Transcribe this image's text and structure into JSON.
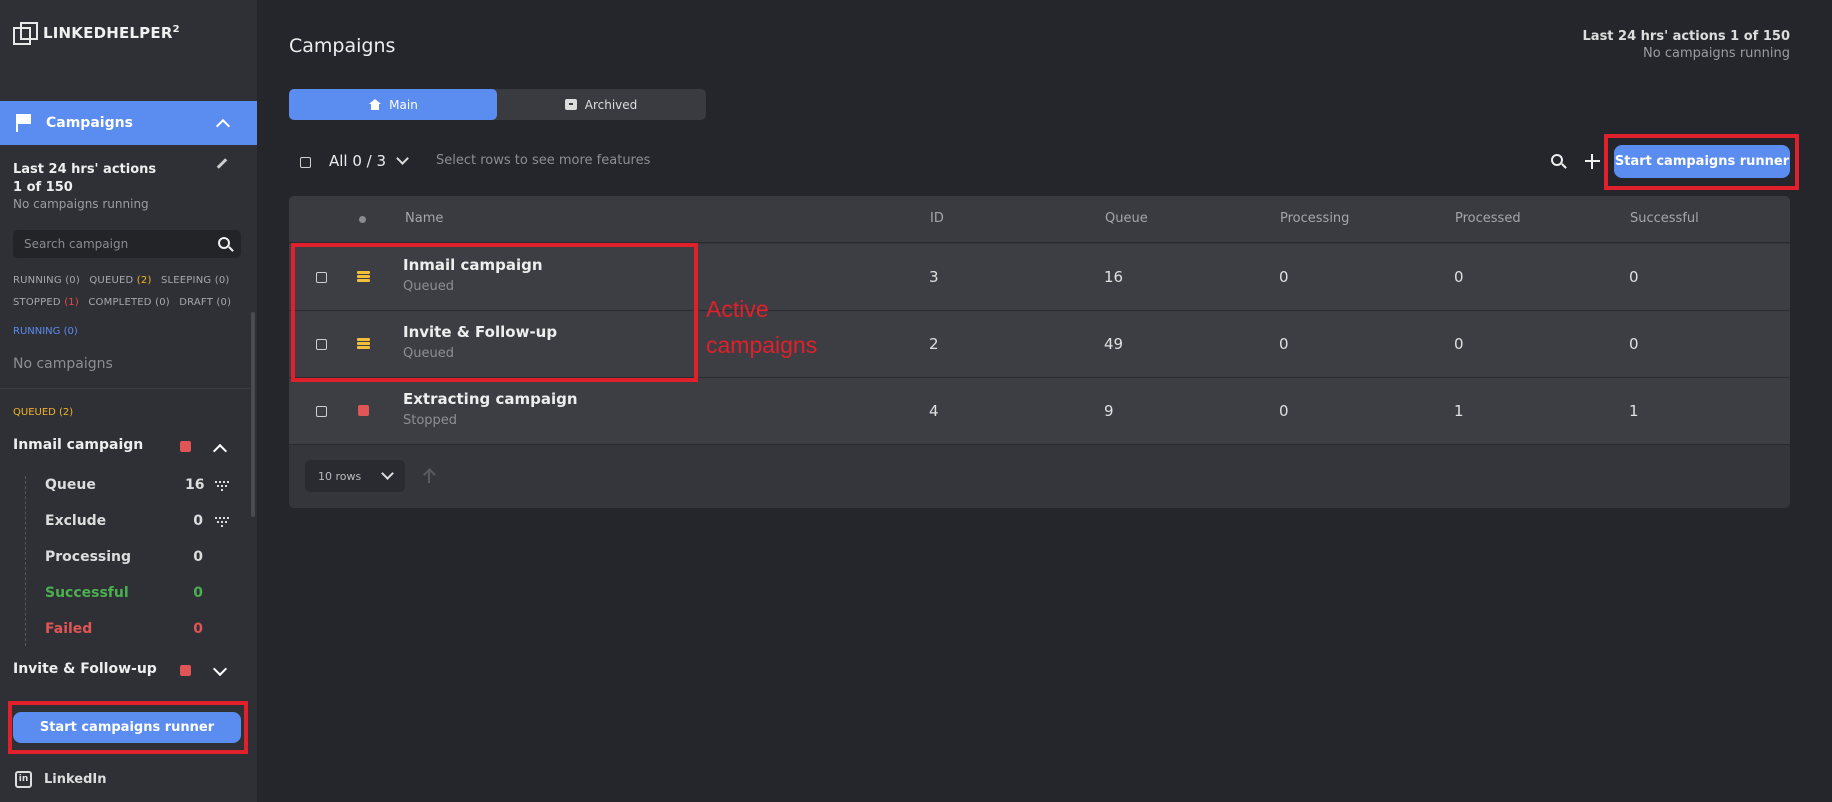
{
  "app": {
    "name": "LINKEDHELPER",
    "version_sup": "2"
  },
  "sidebar": {
    "campaigns_label": "Campaigns",
    "actions_title_l1": "Last 24 hrs' actions",
    "actions_title_l2": "1 of 150",
    "actions_sub": "No campaigns running",
    "search_placeholder": "Search campaign",
    "filters": {
      "running": "RUNNING",
      "running_count": "(0)",
      "queued": "QUEUED",
      "queued_count": "(2)",
      "sleeping": "SLEEPING",
      "sleeping_count": "(0)",
      "stopped": "STOPPED",
      "stopped_count": "(1)",
      "completed": "COMPLETED",
      "completed_count": "(0)",
      "draft": "DRAFT",
      "draft_count": "(0)"
    },
    "section_running": "RUNNING (0)",
    "no_campaigns": "No campaigns",
    "section_queued": "QUEUED (2)",
    "campaign1": {
      "name": "Inmail campaign",
      "stats": [
        {
          "label": "Queue",
          "value": "16"
        },
        {
          "label": "Exclude",
          "value": "0"
        },
        {
          "label": "Processing",
          "value": "0"
        },
        {
          "label": "Successful",
          "value": "0"
        },
        {
          "label": "Failed",
          "value": "0"
        }
      ]
    },
    "campaign2": {
      "name": "Invite & Follow-up"
    },
    "runner_label": "Start campaigns runner",
    "linkedin_label": "LinkedIn"
  },
  "header": {
    "title": "Campaigns",
    "actions_line": "Last 24 hrs' actions 1 of 150",
    "running_line": "No campaigns running"
  },
  "tabs": [
    {
      "label": "Main",
      "icon": "home-icon"
    },
    {
      "label": "Archived",
      "icon": "archive-icon"
    }
  ],
  "toolbar": {
    "all_count": "All 0 / 3",
    "select_hint": "Select rows to see more features",
    "runner_label": "Start campaigns runner"
  },
  "table": {
    "columns": [
      "Name",
      "ID",
      "Queue",
      "Processing",
      "Processed",
      "Successful"
    ],
    "rows": [
      {
        "name": "Inmail campaign",
        "status": "Queued",
        "id": "3",
        "queue": "16",
        "processing": "0",
        "processed": "0",
        "successful": "0"
      },
      {
        "name": "Invite & Follow-up",
        "status": "Queued",
        "id": "2",
        "queue": "49",
        "processing": "0",
        "processed": "0",
        "successful": "0"
      },
      {
        "name": "Extracting campaign",
        "status": "Stopped",
        "id": "4",
        "queue": "9",
        "processing": "0",
        "processed": "1",
        "successful": "1"
      }
    ],
    "rows_per_page": "10 rows"
  },
  "annotation": {
    "line1": "Active",
    "line2": "campaigns"
  },
  "colors": {
    "accent": "#5b8cf0",
    "queued": "#f0c03a",
    "stopped": "#e05555",
    "success": "#4caf50",
    "annotation": "#e0202a"
  }
}
